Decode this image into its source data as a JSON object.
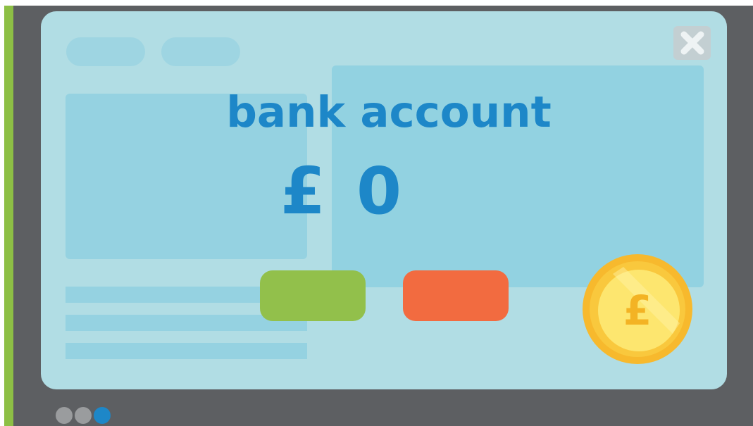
{
  "dialog": {
    "title": "bank account",
    "currency_symbol": "£",
    "balance": "0",
    "coin_symbol": "£"
  },
  "colors": {
    "frame": "#5d5f62",
    "accent_edge": "#8dbf45",
    "window": "#b1dde4",
    "text": "#1d87c8",
    "button_positive": "#92c04b",
    "button_negative": "#f26b40",
    "coin": "#f9c83d"
  },
  "pagination": {
    "total": 3,
    "active_index": 2
  }
}
